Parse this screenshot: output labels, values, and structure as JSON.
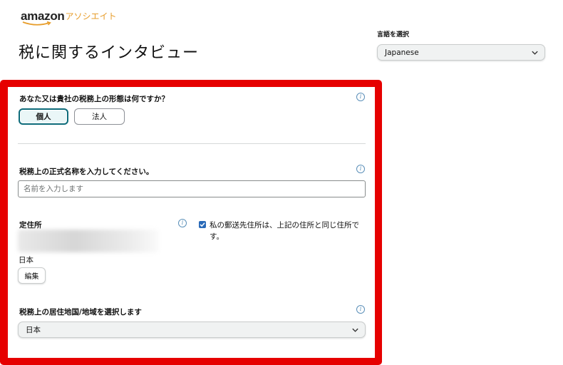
{
  "header": {
    "logo_wordmark": "amazon",
    "logo_suffix": "アソシエイト",
    "page_title": "税に関するインタビュー"
  },
  "language": {
    "label": "言語を選択",
    "selected": "Japanese"
  },
  "form": {
    "entity_type": {
      "question": "あなた又は貴社の税務上の形態は何ですか？",
      "options": [
        "個人",
        "法人"
      ],
      "selected": "個人"
    },
    "legal_name": {
      "label": "税務上の正式名称を入力してください。",
      "placeholder": "名前を入力します",
      "value": ""
    },
    "address": {
      "label": "定住所",
      "country": "日本",
      "edit_label": "編集",
      "mailing_same_checked": true,
      "mailing_same_label": "私の郵送先住所は、上記の住所と同じ住所です。"
    },
    "residence": {
      "label": "税務上の居住地国/地域を選択します",
      "selected": "日本"
    }
  },
  "colors": {
    "highlight_frame": "#e60000",
    "selected_border": "#0d6b7a",
    "logo_accent": "#e79d2b",
    "info_icon": "#5a8fb8"
  }
}
